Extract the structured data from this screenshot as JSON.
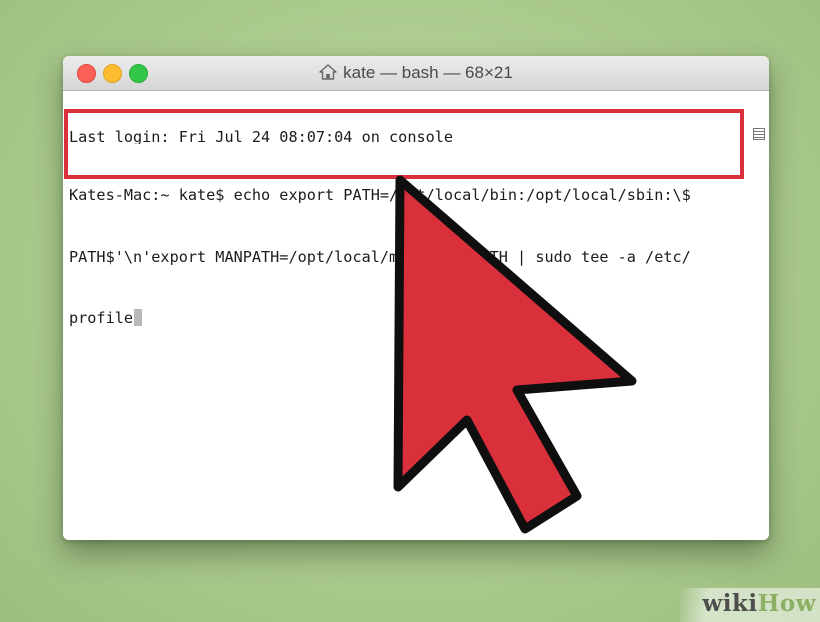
{
  "window": {
    "title": "kate — bash — 68×21",
    "icons": {
      "home": "home-icon",
      "scroll": "scroll-lines-icon"
    }
  },
  "terminal": {
    "lines": [
      "Last login: Fri Jul 24 08:07:04 on console",
      "Kates-Mac:~ kate$ echo export PATH=/opt/local/bin:/opt/local/sbin:\\$",
      "PATH$'\\n'export MANPATH=/opt/local/man:\\$MANPATH | sudo tee -a /etc/",
      "profile"
    ]
  },
  "annotation": {
    "highlight_color": "#d9303b",
    "arrow_color": "#d9303b",
    "arrow_icon": "pointer-arrow-icon"
  },
  "watermark": {
    "wiki": "wiki",
    "how": "How"
  },
  "colors": {
    "background": "#aac98d",
    "close": "#fc5f57",
    "minimize": "#fdbc2e",
    "maximize": "#33c748"
  }
}
